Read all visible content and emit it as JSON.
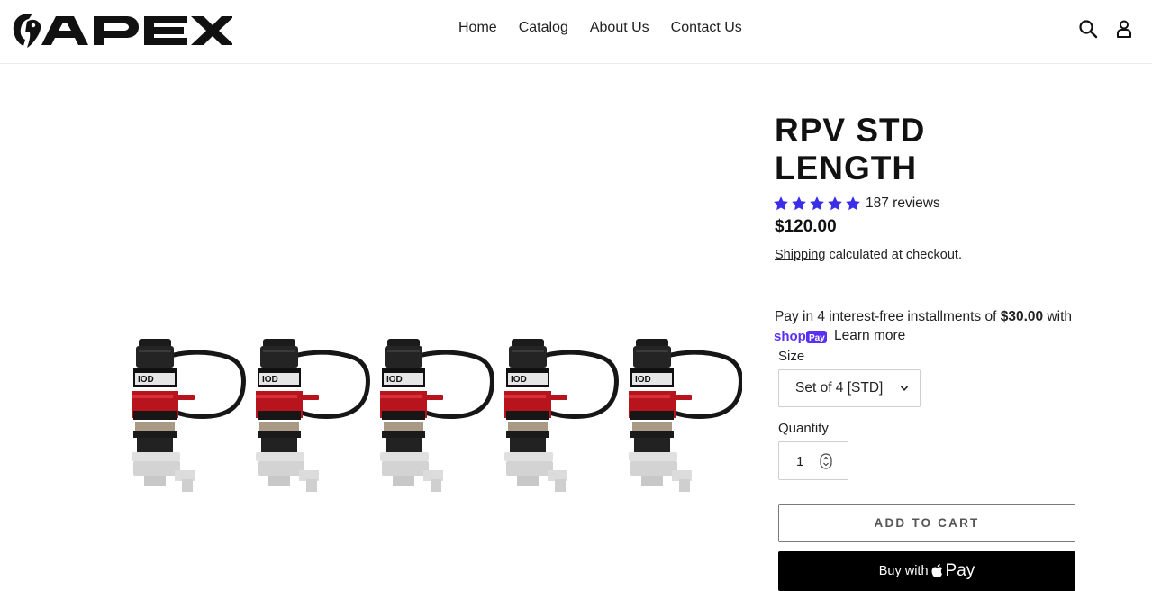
{
  "brand": {
    "name": "APEX"
  },
  "nav": {
    "items": [
      "Home",
      "Catalog",
      "About Us",
      "Contact Us"
    ]
  },
  "product": {
    "title_line1": "RPV STD",
    "title_line2": "LENGTH",
    "rating": 5,
    "reviews": "187 reviews",
    "price": "$120.00",
    "shipping_link": "Shipping",
    "shipping_rest": " calculated at checkout.",
    "installments_prefix": "Pay in 4 interest-free installments of ",
    "installment_amount": "$30.00",
    "installments_suffix": " with",
    "shoppay_brand": "shop Pay",
    "learn_more": "Learn more",
    "size_label": "Size",
    "size_selected": "Set of 4 [STD]",
    "quantity_label": "Quantity",
    "quantity_value": "1",
    "add_to_cart": "ADD TO CART",
    "buy_with": "Buy with",
    "pay_word": "Pay"
  },
  "colors": {
    "star": "#3a2ee8",
    "shoppay": "#5a31f4",
    "accent_red": "#b8141e",
    "button_dark": "#000000"
  },
  "icons": [
    "search-icon",
    "account-icon",
    "star-icon",
    "chevron-down-icon",
    "stepper-icon",
    "apple-icon"
  ]
}
